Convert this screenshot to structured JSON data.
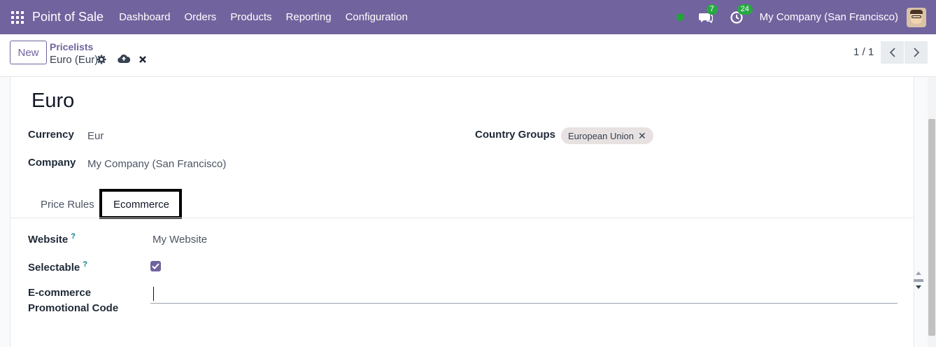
{
  "navbar": {
    "brand": "Point of Sale",
    "menu": [
      "Dashboard",
      "Orders",
      "Products",
      "Reporting",
      "Configuration"
    ],
    "messages_count": "7",
    "activities_count": "24",
    "company": "My Company (San Francisco)",
    "colors": {
      "bar": "#71639e",
      "badge": "#28a745",
      "online": "#22a33a"
    }
  },
  "control": {
    "new_label": "New",
    "breadcrumb": "Pricelists",
    "record": "Euro (Eur)",
    "pager": "1 / 1"
  },
  "form": {
    "title": "Euro",
    "currency_label": "Currency",
    "currency_value": "Eur",
    "company_label": "Company",
    "company_value": "My Company (San Francisco)",
    "country_groups_label": "Country Groups",
    "country_group_tag": "European Union",
    "tabs": [
      "Price Rules",
      "Ecommerce"
    ],
    "active_tab": "Ecommerce",
    "website_label": "Website",
    "website_value": "My Website",
    "selectable_label": "Selectable",
    "selectable_checked": true,
    "promo_label_line1": "E-commerce",
    "promo_label_line2": "Promotional Code",
    "promo_value": "",
    "help_mark": "?"
  }
}
